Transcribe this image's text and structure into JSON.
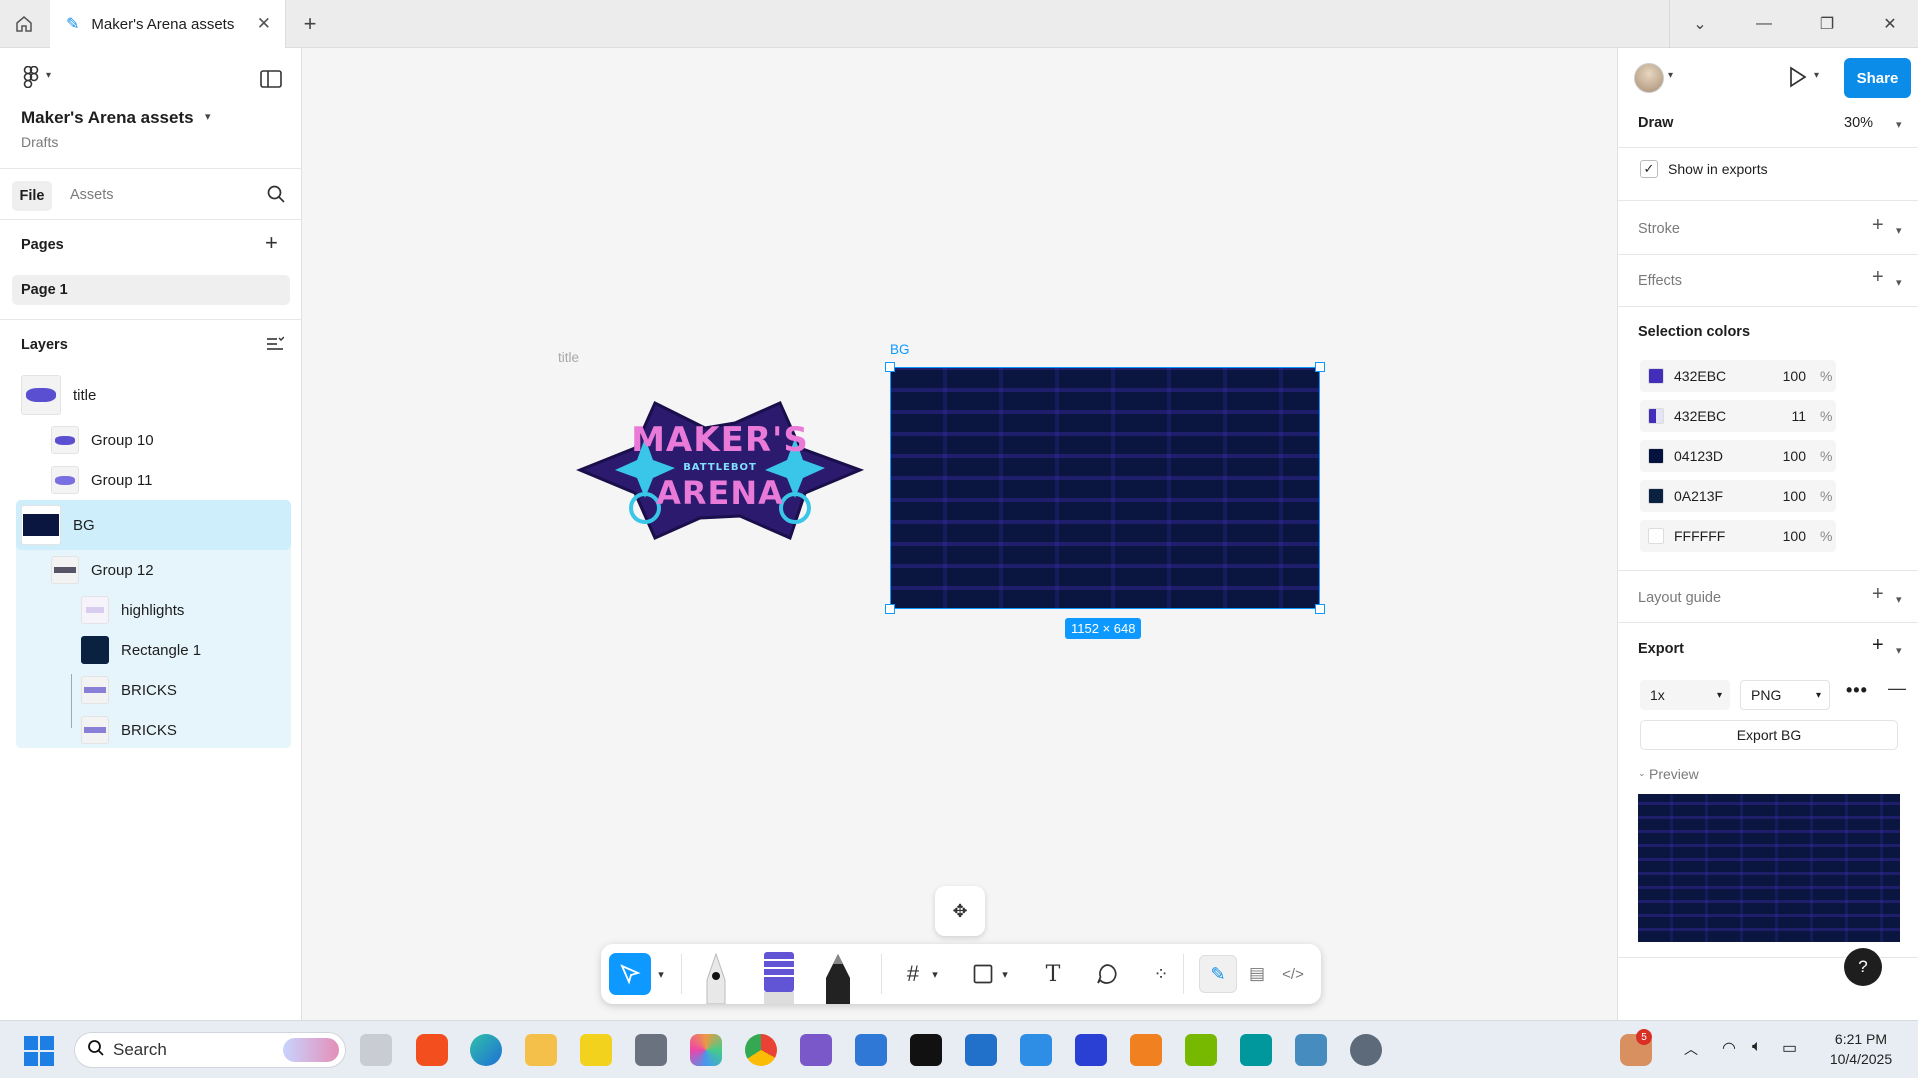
{
  "window": {
    "tab_title": "Maker's Arena assets",
    "new_tab_label": "+"
  },
  "left_panel": {
    "file_name": "Maker's Arena assets",
    "location": "Drafts",
    "tabs": [
      "File",
      "Assets"
    ],
    "pages_header": "Pages",
    "pages": [
      "Page 1"
    ],
    "layers_header": "Layers",
    "layers": [
      {
        "name": "title",
        "indent": 0
      },
      {
        "name": "Group 10",
        "indent": 1
      },
      {
        "name": "Group 11",
        "indent": 1
      },
      {
        "name": "BG",
        "indent": 0,
        "selected": true
      },
      {
        "name": "Group 12",
        "indent": 1
      },
      {
        "name": "highlights",
        "indent": 2
      },
      {
        "name": "Rectangle 1",
        "indent": 2
      },
      {
        "name": "BRICKS",
        "indent": 2
      },
      {
        "name": "BRICKS",
        "indent": 2
      }
    ]
  },
  "canvas": {
    "frame_title_label": "title",
    "logo_line1": "MAKER'S",
    "logo_line2": "BATTLEBOT",
    "logo_line3": "ARENA",
    "frame_bg_label": "BG",
    "dimensions": "1152 × 648"
  },
  "right_panel": {
    "share_label": "Share",
    "mode_label": "Draw",
    "zoom": "30%",
    "show_in_exports": "Show in exports",
    "show_in_exports_checked": true,
    "stroke": "Stroke",
    "effects": "Effects",
    "selection_colors": "Selection colors",
    "colors": [
      {
        "hex": "432EBC",
        "opacity": "100",
        "swatch": "#432EBC"
      },
      {
        "hex": "432EBC",
        "opacity": "11",
        "swatch": "#432EBC"
      },
      {
        "hex": "04123D",
        "opacity": "100",
        "swatch": "#04123D"
      },
      {
        "hex": "0A213F",
        "opacity": "100",
        "swatch": "#0A213F"
      },
      {
        "hex": "FFFFFF",
        "opacity": "100",
        "swatch": "#FFFFFF"
      }
    ],
    "percent_sign": "%",
    "layout_guide": "Layout guide",
    "export": "Export",
    "export_scale": "1x",
    "export_format": "PNG",
    "export_button": "Export BG",
    "preview": "Preview",
    "help": "?"
  },
  "taskbar": {
    "search_placeholder": "Search",
    "time": "6:21 PM",
    "date": "10/4/2025",
    "notification_count": "5"
  },
  "colors": {
    "accent": "#0d99ff",
    "share_button": "#0c8ce9",
    "selection_bg": "#daf0fb",
    "bg_frame": "#0a1640"
  }
}
